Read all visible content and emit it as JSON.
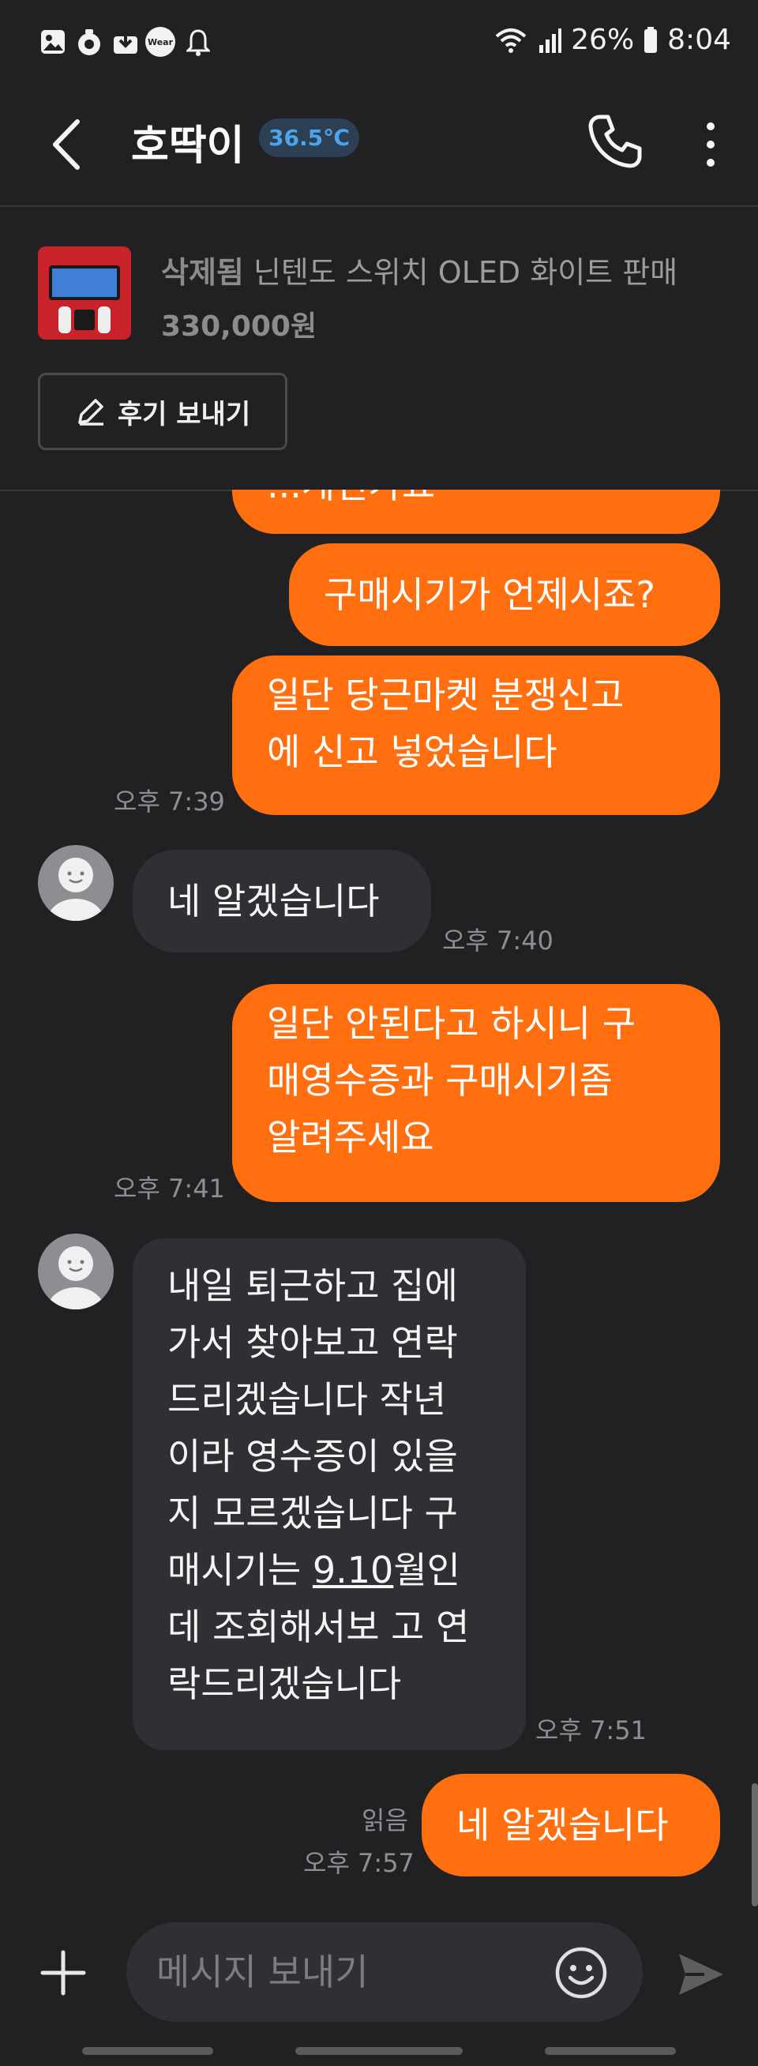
{
  "status_bar": {
    "icons": [
      "gallery-icon",
      "app-icon",
      "download-icon",
      "wear-icon",
      "bell-icon",
      "wifi-icon",
      "signal-icon",
      "battery-icon"
    ],
    "wear_label": "Wear",
    "battery": "26%",
    "time": "8:04"
  },
  "header": {
    "title": "호딱이",
    "temperature": "36.5℃"
  },
  "product": {
    "status": "삭제됨",
    "name": "닌텐도 스위치 OLED 화이트 판매",
    "price": "330,000원",
    "review_button": "후기 보내기"
  },
  "messages": [
    {
      "side": "mine",
      "text": "...계신가요",
      "time": ""
    },
    {
      "side": "mine",
      "text": "구매시기가 언제시죠?",
      "time": ""
    },
    {
      "side": "mine",
      "lines": [
        "일단 당근마켓 분쟁신고",
        "에 신고 넣었습니다"
      ],
      "time": "오후 7:39"
    },
    {
      "side": "theirs",
      "text": "네 알겠습니다",
      "time": "오후 7:40"
    },
    {
      "side": "mine",
      "lines": [
        "일단 안된다고 하시니 구",
        "매영수증과 구매시기좀",
        "알려주세요"
      ],
      "time": "오후 7:41"
    },
    {
      "side": "theirs",
      "lines": [
        "내일 퇴근하고 집에",
        "가서 찾아보고 연락",
        "드리겠습니다 작년",
        "이라 영수증이 있을",
        "지 모르겠습니다 구",
        "매시기는 9.10월인",
        "데 조회해서보 고 연",
        "락드리겠습니다"
      ],
      "link_text": "9.10",
      "time": "오후 7:51"
    },
    {
      "side": "mine",
      "text": "네 알겠습니다",
      "read": "읽음",
      "time": "오후 7:57"
    }
  ],
  "input": {
    "placeholder": "메시지 보내기"
  },
  "colors": {
    "accent": "#ff6f0f",
    "temperature": "#4ba4ec",
    "background": "#212123"
  }
}
